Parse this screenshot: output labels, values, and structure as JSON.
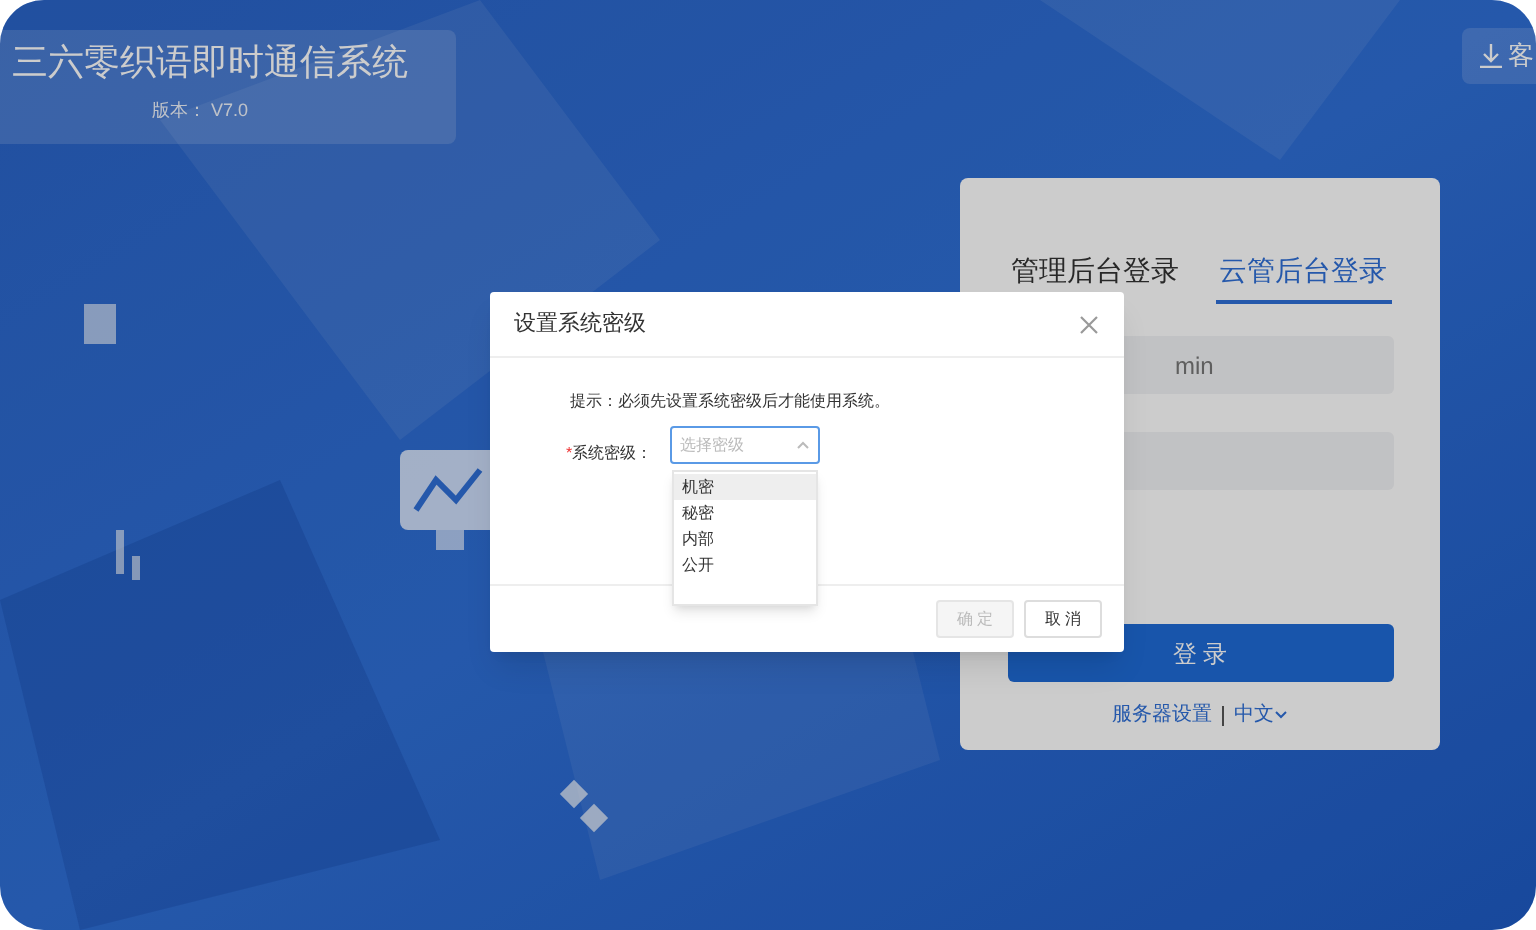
{
  "app": {
    "title": "三六零织语即时通信系统",
    "version": "版本： V7.0"
  },
  "download_button": {
    "label": "客"
  },
  "login": {
    "tabs": [
      {
        "label": "管理后台登录",
        "selected": false
      },
      {
        "label": "云管后台登录",
        "selected": true
      }
    ],
    "username": {
      "value": "min"
    },
    "submit": "登 录",
    "links": [
      {
        "label": "服务器设置",
        "dropdown": false
      },
      {
        "label": "中文",
        "dropdown": true
      }
    ]
  },
  "dialog": {
    "title": "设置系统密级",
    "hint": "提示：必须先设置系统密级后才能使用系统。",
    "field_label": "系统密级：",
    "required_mark": "*",
    "select": {
      "placeholder": "选择密级",
      "expanded": true
    },
    "options": [
      {
        "label": "机密",
        "highlighted": true
      },
      {
        "label": "秘密",
        "highlighted": false
      },
      {
        "label": "内部",
        "highlighted": false
      },
      {
        "label": "公开",
        "highlighted": false
      }
    ],
    "buttons": [
      {
        "label": "确 定",
        "disabled": true
      },
      {
        "label": "取 消",
        "disabled": false
      }
    ]
  }
}
